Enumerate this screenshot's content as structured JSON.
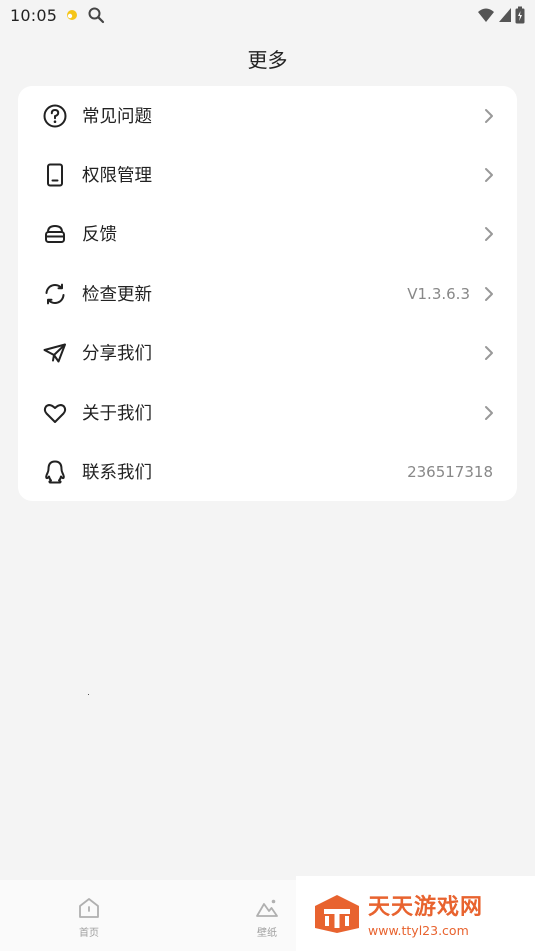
{
  "status_bar": {
    "time": "10:05",
    "icons": [
      "notification-dot-icon",
      "search-icon",
      "wifi-icon",
      "signal-icon",
      "battery-icon"
    ]
  },
  "header": {
    "title": "更多"
  },
  "menu": {
    "items": [
      {
        "label": "常见问题",
        "icon": "question-circle-icon",
        "value": "",
        "has_arrow": true
      },
      {
        "label": "权限管理",
        "icon": "phone-icon",
        "value": "",
        "has_arrow": true
      },
      {
        "label": "反馈",
        "icon": "mailbox-icon",
        "value": "",
        "has_arrow": true
      },
      {
        "label": "检查更新",
        "icon": "refresh-icon",
        "value": "V1.3.6.3",
        "has_arrow": true
      },
      {
        "label": "分享我们",
        "icon": "paper-plane-icon",
        "value": "",
        "has_arrow": true
      },
      {
        "label": "关于我们",
        "icon": "heart-icon",
        "value": "",
        "has_arrow": true
      },
      {
        "label": "联系我们",
        "icon": "qq-penguin-icon",
        "value": "236517318",
        "has_arrow": false
      }
    ]
  },
  "bottom_nav": {
    "items": [
      {
        "label": "首页",
        "icon": "home-icon"
      },
      {
        "label": "壁纸",
        "icon": "wallpaper-icon"
      }
    ]
  },
  "watermark": {
    "title": "天天游戏网",
    "url": "www.ttyl23.com"
  },
  "colors": {
    "background": "#f4f4f4",
    "card": "#ffffff",
    "text": "#222222",
    "secondary": "#888888",
    "watermark": "#e8632f"
  }
}
